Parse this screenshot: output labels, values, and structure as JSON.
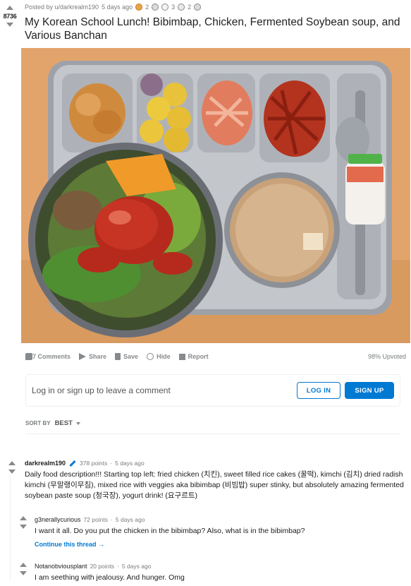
{
  "post": {
    "score": "8736",
    "posted_by": "Posted by u/darkrealm190",
    "time": "5 days ago",
    "award_counts": [
      "2",
      "3",
      "2"
    ],
    "title": "My Korean School Lunch! Bibimbap, Chicken, Fermented Soybean soup, and Various Banchan"
  },
  "actions": {
    "comments": "377 Comments",
    "share": "Share",
    "save": "Save",
    "hide": "Hide",
    "report": "Report",
    "upvoted": "98% Upvoted"
  },
  "login_prompt": {
    "text": "Log in or sign up to leave a comment",
    "login_label": "LOG IN",
    "signup_label": "SIGN UP"
  },
  "sort": {
    "label": "SORT BY",
    "value": "BEST"
  },
  "comments": [
    {
      "author": "darkrealm190",
      "points": "378 points",
      "time": "5 days ago",
      "body": "Daily food description!!! Starting top left:  fried chicken (치킨), sweet filled rice cakes (꿀떡), kimchi (김치) dried radish kimchi (무말랭이무침), mixed rice with veggies aka bibimbap (비빔밥) super stinky, but absolutely amazing fermented soybean paste soup (청국장), yogurt drink! (요구르트)"
    },
    {
      "author": "g3nerallycurious",
      "points": "72 points",
      "time": "5 days ago",
      "body": "I want it all. Do you put the chicken in the bibimbap? Also, what is in the bibimbap?",
      "continue": "Continue this thread"
    },
    {
      "author": "Notanobviousplant",
      "points": "20 points",
      "time": "5 days ago",
      "body": "I am seething with jealousy. And hunger. Omg"
    }
  ],
  "colors": {
    "accent": "#0079d3",
    "meta": "#787c7e",
    "tray": "#b9bcc2",
    "table": "#e4a86f"
  }
}
